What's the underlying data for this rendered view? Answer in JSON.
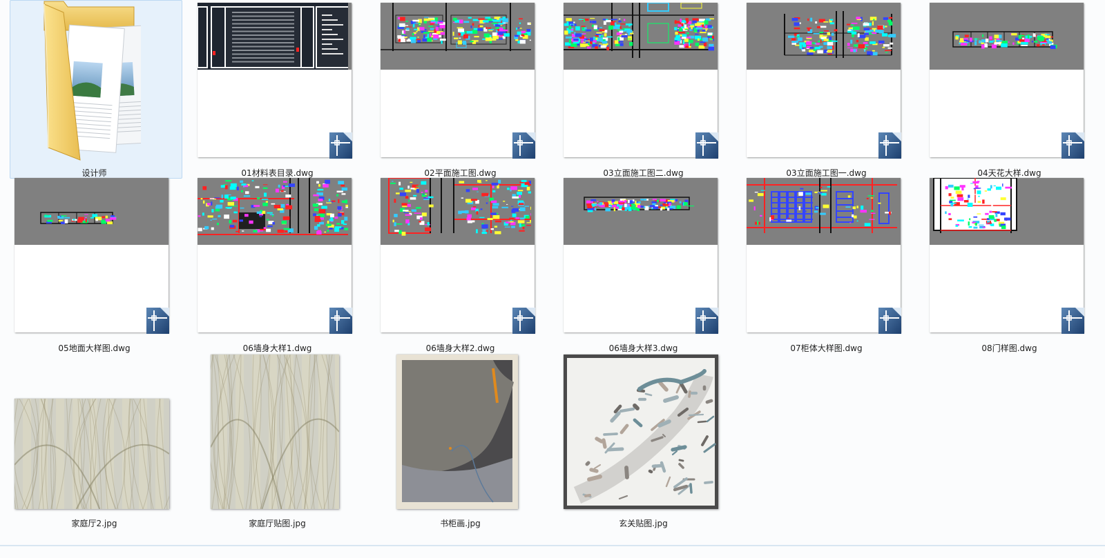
{
  "files": [
    {
      "name": "设计师",
      "kind": "folder",
      "selected": true
    },
    {
      "name": "01材料表目录.dwg",
      "kind": "dwg",
      "preview": "dark-index"
    },
    {
      "name": "02平面施工图.dwg",
      "kind": "dwg",
      "preview": "plans"
    },
    {
      "name": "03立面施工图二.dwg",
      "kind": "dwg",
      "preview": "elevations"
    },
    {
      "name": "03立面施工图一.dwg",
      "kind": "dwg",
      "preview": "elevations-small"
    },
    {
      "name": "04天花大样.dwg",
      "kind": "dwg",
      "preview": "strip"
    },
    {
      "name": "05地面大样图.dwg",
      "kind": "dwg",
      "preview": "tiny-strip"
    },
    {
      "name": "06墙身大样1.dwg",
      "kind": "dwg",
      "preview": "detail-red"
    },
    {
      "name": "06墙身大样2.dwg",
      "kind": "dwg",
      "preview": "detail-red2"
    },
    {
      "name": "06墙身大样3.dwg",
      "kind": "dwg",
      "preview": "long-strip"
    },
    {
      "name": "07柜体大样图.dwg",
      "kind": "dwg",
      "preview": "cabinet"
    },
    {
      "name": "08门样图.dwg",
      "kind": "dwg",
      "preview": "door"
    },
    {
      "name": "家庭厅2.jpg",
      "kind": "image",
      "preview": "fabric-wide"
    },
    {
      "name": "家庭厅贴图.jpg",
      "kind": "image",
      "preview": "fabric-tall"
    },
    {
      "name": "书柜画.jpg",
      "kind": "image",
      "preview": "stone-painting"
    },
    {
      "name": "玄关贴图.jpg",
      "kind": "image",
      "preview": "ink-painting"
    }
  ]
}
